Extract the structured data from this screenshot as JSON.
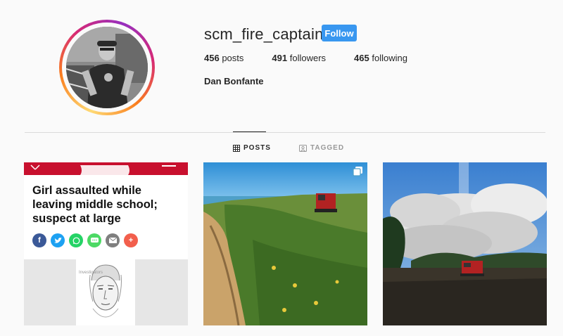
{
  "profile": {
    "username": "scm_fire_captain",
    "follow_label": "Follow",
    "full_name": "Dan Bonfante",
    "stats": {
      "posts_count": "456",
      "posts_label": "posts",
      "followers_count": "491",
      "followers_label": "followers",
      "following_count": "465",
      "following_label": "following"
    }
  },
  "tabs": [
    {
      "label": "POSTS",
      "icon": "grid-icon",
      "active": true
    },
    {
      "label": "TAGGED",
      "icon": "tag-person-icon",
      "active": false
    }
  ],
  "posts": [
    {
      "kind": "news-screenshot",
      "headline": "Girl assaulted while leaving middle school; suspect at large",
      "share_icons": [
        "facebook-icon",
        "twitter-icon",
        "whatsapp-icon",
        "sms-icon",
        "email-icon",
        "more-icon"
      ]
    },
    {
      "kind": "photo",
      "scene": "fire-truck-on-coastal-cliff",
      "multi": true
    },
    {
      "kind": "photo",
      "scene": "fire-truck-in-smoke",
      "multi": false
    }
  ],
  "colors": {
    "accent": "#3897f0",
    "text": "#262626",
    "muted": "#999999",
    "news_red": "#c8102e"
  }
}
